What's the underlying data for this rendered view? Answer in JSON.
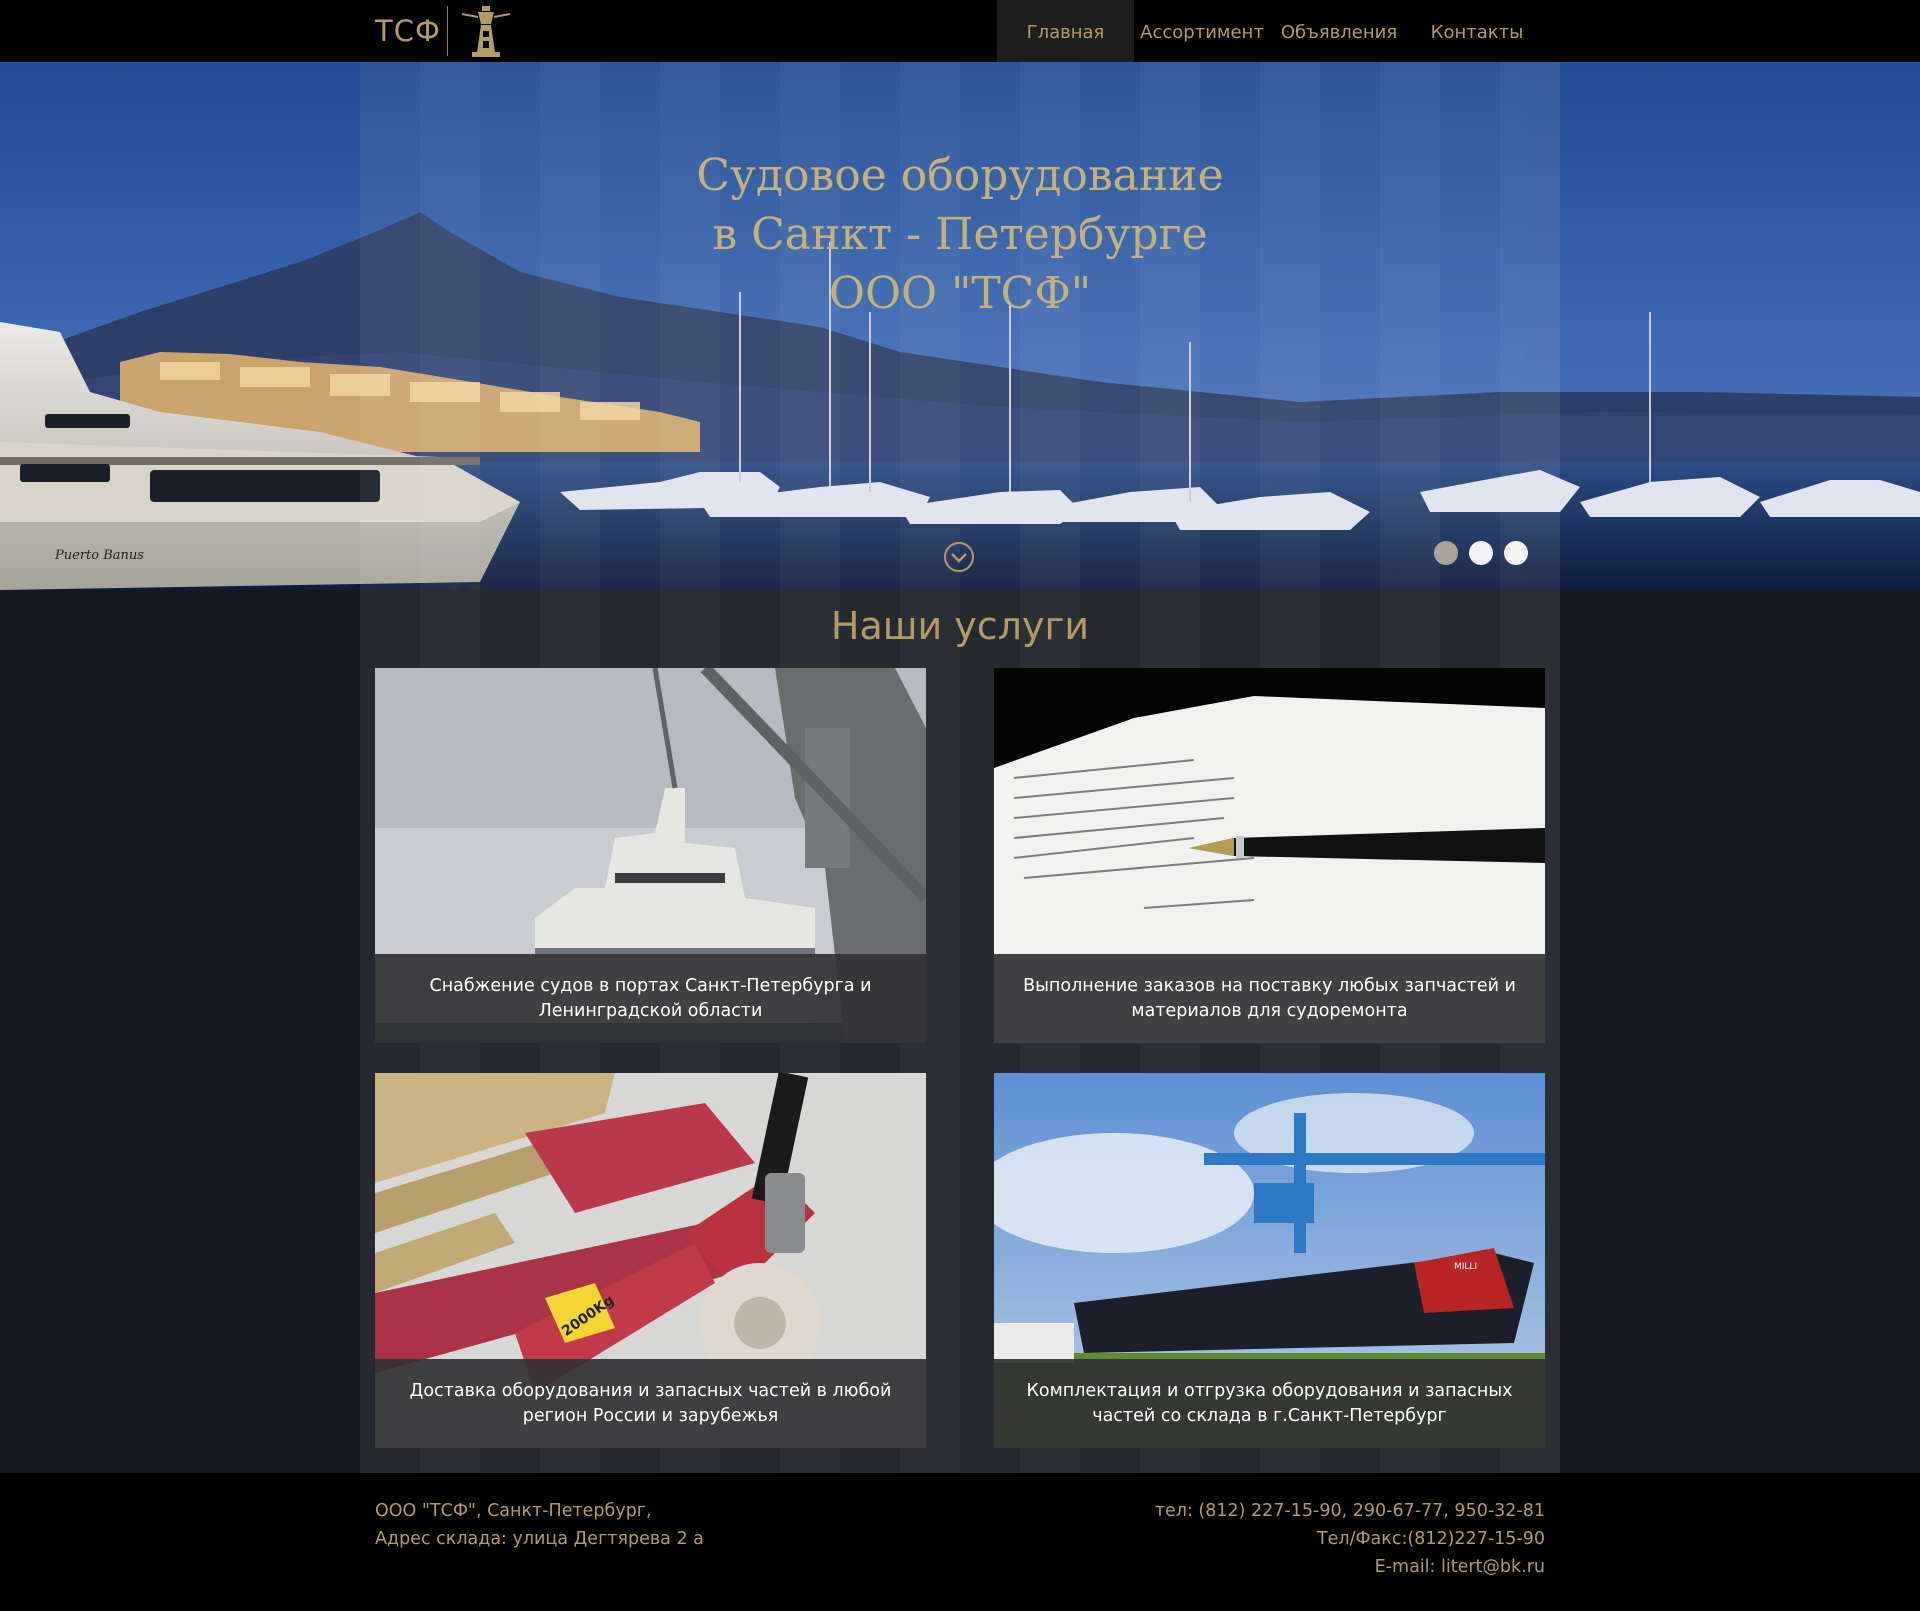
{
  "header": {
    "logo_text": "ТСФ",
    "nav": [
      {
        "label": "Главная",
        "active": true
      },
      {
        "label": "Ассортимент",
        "active": false
      },
      {
        "label": "Объявления",
        "active": false
      },
      {
        "label": "Контакты",
        "active": false
      }
    ]
  },
  "hero": {
    "title_lines": [
      "Судовое оборудование",
      "в Санкт - Петербурге",
      "ООО \"ТСФ\""
    ],
    "yacht_name": "Puerto Banus",
    "slides_count": 3,
    "active_slide": 0
  },
  "services": {
    "title": "Наши услуги",
    "cards": [
      {
        "caption": "Снабжение судов в портах Санкт-Петербурга и Ленинградской области",
        "image": "ship-port-photo"
      },
      {
        "caption": "Выполнение заказов на поставку любых запчастей и материалов для судоремонта",
        "image": "document-pen-photo"
      },
      {
        "caption": "Доставка оборудования и запасных частей в любой регион России и зарубежья",
        "image": "pallet-jack-photo",
        "jack_label": "2000Kg"
      },
      {
        "caption": "Комплектация и отгрузка оборудования и запасных частей со склада в г.Санкт-Петербург",
        "image": "shipyard-photo",
        "ship_label": "MILLI"
      }
    ]
  },
  "footer": {
    "left": [
      "ООО \"ТСФ\", Санкт-Петербург,",
      "Адрес склада: улица Дегтярева 2 а"
    ],
    "right": [
      "тел: (812) 227-15-90, 290-67-77, 950-32-81",
      "Тел/Факс:(812)227-15-90",
      "E-mail: litert@bk.ru"
    ]
  },
  "colors": {
    "accent_gold": "#b49a63",
    "header_bg": "#020202",
    "page_bg": "#15181d"
  }
}
